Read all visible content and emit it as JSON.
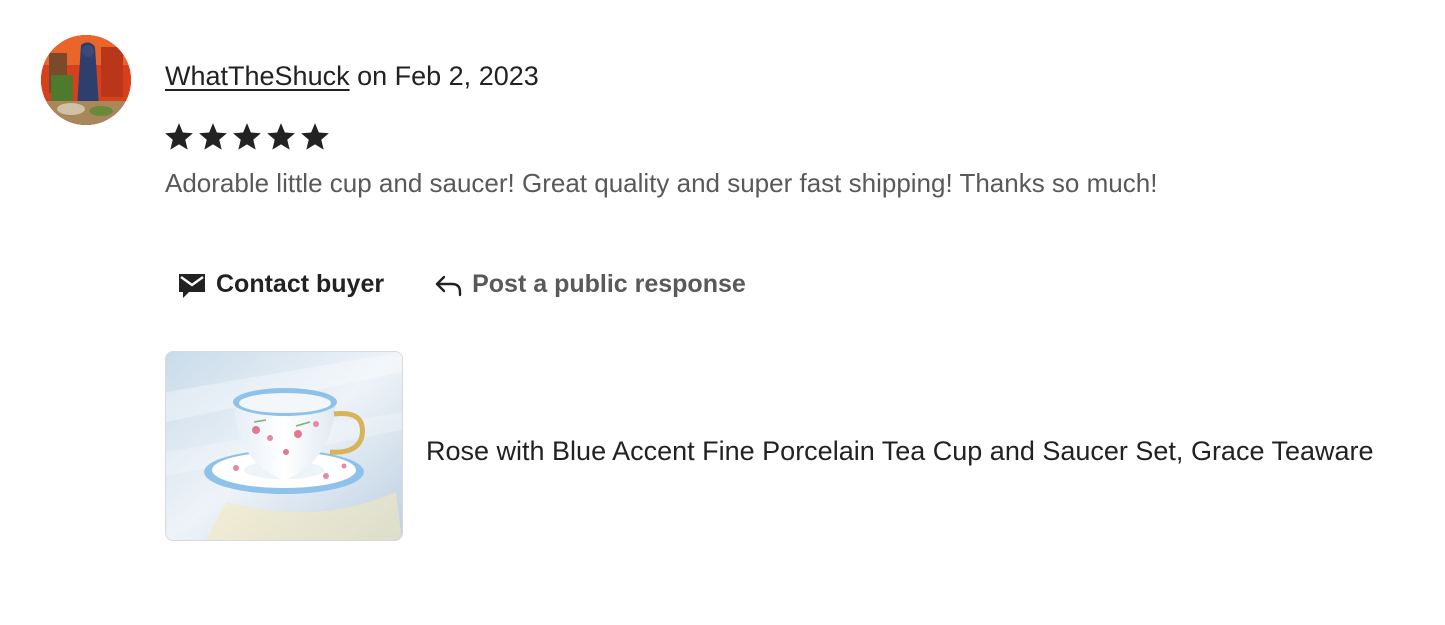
{
  "review": {
    "reviewer_name": "WhatTheShuck",
    "date_text": "on Feb 2, 2023",
    "rating": 5,
    "rating_max": 5,
    "text": "Adorable little cup and saucer! Great quality and super fast shipping! Thanks so much!"
  },
  "actions": {
    "contact_label": "Contact buyer",
    "contact_icon": "envelope-icon",
    "respond_label": "Post a public response",
    "respond_icon": "reply-arrow-icon"
  },
  "product": {
    "title": "Rose with Blue Accent Fine Porcelain Tea Cup and Saucer Set, Grace Teaware"
  },
  "colors": {
    "text_primary": "#222222",
    "text_secondary": "#595959",
    "star": "#222222",
    "thumb_border": "#d9d9d9"
  }
}
